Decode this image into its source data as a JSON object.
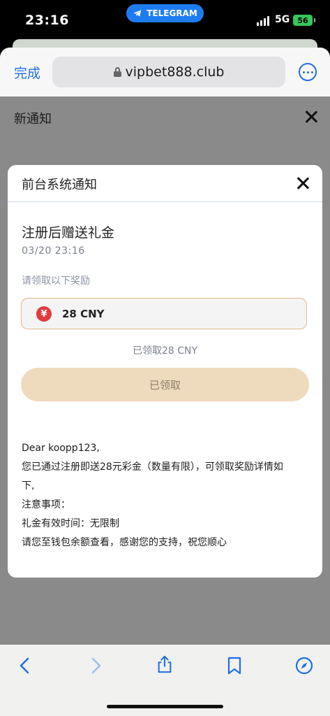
{
  "status_bar": {
    "time": "23:16",
    "app_pill": "TELEGRAM",
    "network": "5G",
    "battery": "56"
  },
  "browser": {
    "done_label": "完成",
    "url": "vipbet888.club"
  },
  "page": {
    "header_title": "新通知"
  },
  "modal": {
    "title": "前台系统通知",
    "gift_title": "注册后赠送礼金",
    "date": "03/20 23:16",
    "claim_hint": "请领取以下奖励",
    "reward_icon": "¥",
    "reward_amount": "28 CNY",
    "claimed_text": "已领取28 CNY",
    "claim_button": "已领取",
    "body": {
      "line1": "Dear koopp123,",
      "line2": "您已通过注册即送28元彩金（数量有限），可领取奖励详情如",
      "line3": "下,",
      "line4": "注意事项：",
      "line5": "礼金有效时间：无限制",
      "line6": "请您至钱包余额查看，感谢您的支持，祝您顺心"
    }
  },
  "icons": {
    "app_pill": "telegram-icon",
    "toolbar": [
      "back-icon",
      "forward-icon",
      "share-icon",
      "bookmarks-icon",
      "compass-icon"
    ]
  },
  "colors": {
    "accent": "#1f6fe0",
    "reward_border": "#e2b78b",
    "claim_button_bg": "#eedbbd",
    "yen_badge": "#e23a3a",
    "battery": "#34c759"
  }
}
